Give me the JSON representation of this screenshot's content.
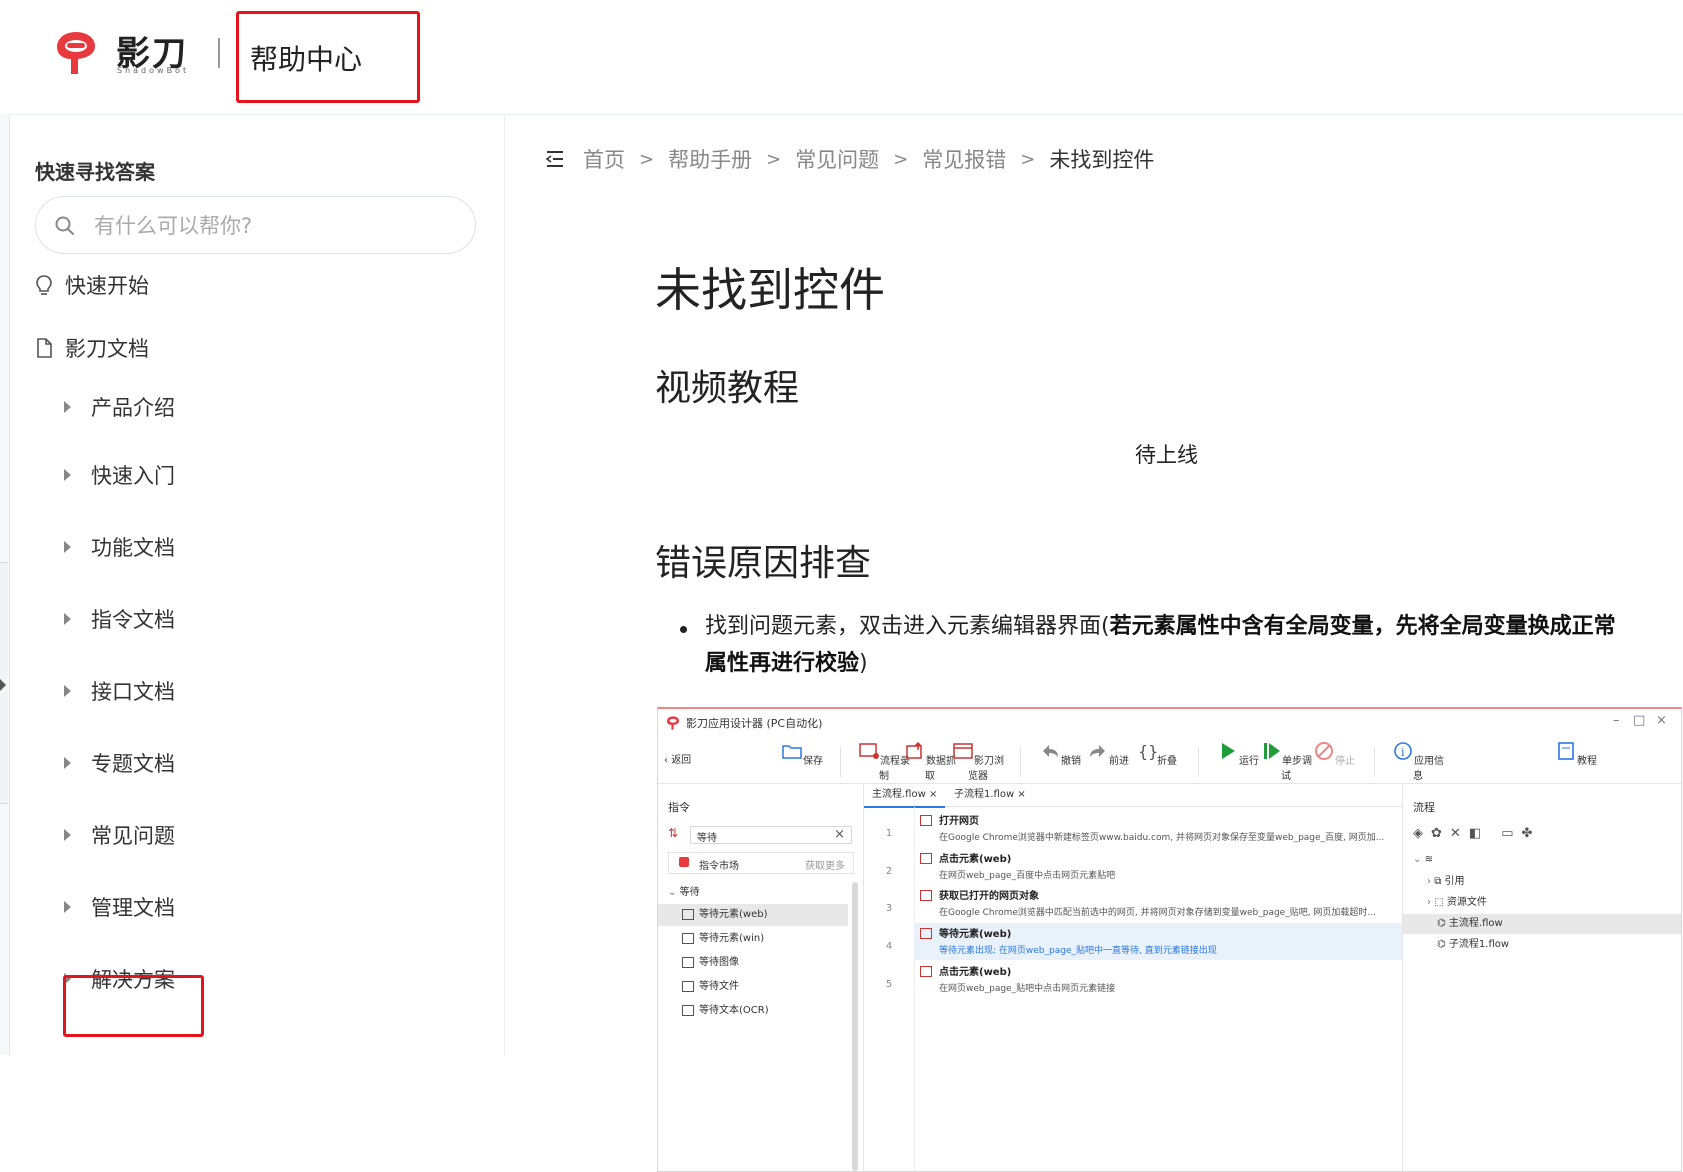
{
  "header": {
    "logo_text": "影刀",
    "logo_sub": "ShadowBot",
    "help_title": "帮助中心"
  },
  "sidebar": {
    "quick_title": "快速寻找答案",
    "search_placeholder": "有什么可以帮你?",
    "top_items": [
      {
        "label": "快速开始",
        "icon": "lightbulb-icon"
      },
      {
        "label": "影刀文档",
        "icon": "document-icon"
      }
    ],
    "items": [
      {
        "label": "产品介绍"
      },
      {
        "label": "快速入门"
      },
      {
        "label": "功能文档"
      },
      {
        "label": "指令文档"
      },
      {
        "label": "接口文档"
      },
      {
        "label": "专题文档"
      },
      {
        "label": "常见问题"
      },
      {
        "label": "管理文档"
      },
      {
        "label": "解决方案"
      }
    ]
  },
  "breadcrumb": [
    "首页",
    "帮助手册",
    "常见问题",
    "常见报错",
    "未找到控件"
  ],
  "article": {
    "title": "未找到控件",
    "section1": "视频教程",
    "pending": "待上线",
    "section2": "错误原因排查",
    "bullet_plain": "找到问题元素，双击进入元素编辑器界面(",
    "bullet_bold": "若元素属性中含有全局变量，先将全局变量换成正常属性再进行校验",
    "bullet_end": ")"
  },
  "embedded": {
    "window_title": "影刀应用设计器 (PC自动化)",
    "back_label": "返回",
    "toolbar": [
      "保存",
      "流程录制",
      "数据抓取",
      "影刀浏览器",
      "撤销",
      "前进",
      "折叠",
      "运行",
      "单步调试",
      "停止",
      "应用信息",
      "教程"
    ],
    "left_title": "指令",
    "search_value": "等待",
    "market_label": "指令市场",
    "market_more": "获取更多",
    "group_label": "等待",
    "commands": [
      "等待元素(web)",
      "等待元素(win)",
      "等待图像",
      "等待文件",
      "等待文本(OCR)"
    ],
    "tabs": [
      "主流程.flow",
      "子流程1.flow"
    ],
    "steps": [
      {
        "num": "1",
        "title": "打开网页",
        "desc": "在Google Chrome浏览器中新建标签页www.baidu.com, 并将网页对象保存至变量web_page_百度, 网页加..."
      },
      {
        "num": "2",
        "title": "点击元素(web)",
        "desc": "在网页web_page_百度中点击网页元素贴吧"
      },
      {
        "num": "3",
        "title": "获取已打开的网页对象",
        "desc": "在Google Chrome浏览器中匹配当前选中的网页, 并将网页对象存储到变量web_page_贴吧, 网页加载超时..."
      },
      {
        "num": "4",
        "title": "等待元素(web)",
        "desc": "等待元素出现: 在网页web_page_贴吧中一直等待, 直到元素链接出现"
      },
      {
        "num": "5",
        "title": "点击元素(web)",
        "desc": "在网页web_page_贴吧中点击网页元素链接"
      }
    ],
    "right_title": "流程",
    "tree": [
      "引用",
      "资源文件",
      "主流程.flow",
      "子流程1.flow"
    ]
  }
}
